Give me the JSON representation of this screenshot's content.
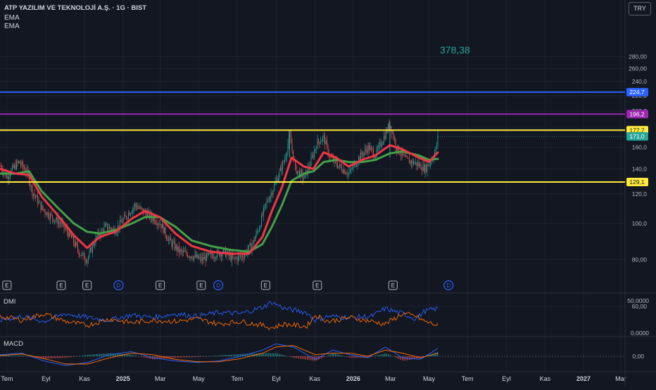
{
  "header": {
    "title": "ATP YAZILIM VE TEKNOLOJİ A.Ş. · 1G · BIST",
    "indicators": [
      "EMA",
      "EMA"
    ],
    "currency": "TRY"
  },
  "annotation": "378,38",
  "chart_data": [
    {
      "type": "line",
      "subtype": "candlestick price chart with EMA overlays",
      "y_axis": {
        "scale": "log",
        "ticks": [
          "280,00",
          "260,00",
          "240,0",
          "220,0",
          "200,0",
          "180,0",
          "160,0",
          "140,0",
          "120,0",
          "100,0",
          "80,00",
          "60,00"
        ],
        "values": [
          280,
          260,
          240,
          220,
          200,
          180,
          160,
          140,
          120,
          100,
          80,
          60
        ]
      },
      "x_axis": {
        "ticks": [
          "Tem",
          "Eyl",
          "Kas",
          "2025",
          "Mar",
          "May",
          "Tem",
          "Eyl",
          "Kas",
          "2026",
          "Mar",
          "May",
          "Tem",
          "Eyl",
          "Kas",
          "2027",
          "Mar"
        ]
      },
      "price_path": [
        [
          "2024-06-20",
          143
        ],
        [
          "2024-07-01",
          133
        ],
        [
          "2024-07-10",
          140
        ],
        [
          "2024-07-20",
          146
        ],
        [
          "2024-08-01",
          138
        ],
        [
          "2024-08-10",
          122
        ],
        [
          "2024-08-25",
          110
        ],
        [
          "2024-09-10",
          104
        ],
        [
          "2024-09-25",
          100
        ],
        [
          "2024-10-10",
          92
        ],
        [
          "2024-10-25",
          83
        ],
        [
          "2024-11-05",
          80
        ],
        [
          "2024-11-20",
          92
        ],
        [
          "2024-12-05",
          98
        ],
        [
          "2024-12-20",
          96
        ],
        [
          "2025-01-05",
          104
        ],
        [
          "2025-01-20",
          112
        ],
        [
          "2025-02-01",
          108
        ],
        [
          "2025-02-15",
          104
        ],
        [
          "2025-03-01",
          100
        ],
        [
          "2025-03-15",
          90
        ],
        [
          "2025-04-01",
          84
        ],
        [
          "2025-04-20",
          82
        ],
        [
          "2025-05-05",
          80
        ],
        [
          "2025-05-20",
          82
        ],
        [
          "2025-06-10",
          84
        ],
        [
          "2025-06-25",
          80
        ],
        [
          "2025-07-10",
          82
        ],
        [
          "2025-07-25",
          88
        ],
        [
          "2025-08-05",
          98
        ],
        [
          "2025-08-15",
          112
        ],
        [
          "2025-08-25",
          122
        ],
        [
          "2025-09-05",
          135
        ],
        [
          "2025-09-15",
          150
        ],
        [
          "2025-09-22",
          172
        ],
        [
          "2025-10-01",
          140
        ],
        [
          "2025-10-15",
          132
        ],
        [
          "2025-10-25",
          145
        ],
        [
          "2025-11-05",
          165
        ],
        [
          "2025-11-15",
          170
        ],
        [
          "2025-11-25",
          150
        ],
        [
          "2025-12-10",
          142
        ],
        [
          "2025-12-25",
          136
        ],
        [
          "2026-01-10",
          150
        ],
        [
          "2026-01-25",
          160
        ],
        [
          "2026-02-05",
          152
        ],
        [
          "2026-02-20",
          172
        ],
        [
          "2026-02-28",
          185
        ],
        [
          "2026-03-10",
          160
        ],
        [
          "2026-03-25",
          148
        ],
        [
          "2026-04-10",
          145
        ],
        [
          "2026-04-25",
          140
        ],
        [
          "2026-05-05",
          148
        ],
        [
          "2026-05-12",
          158
        ],
        [
          "2026-05-15",
          170
        ]
      ],
      "series": [
        {
          "name": "EMA",
          "color": "#f23645",
          "values": [
            [
              "2024-06-20",
              140
            ],
            [
              "2024-07-15",
              136
            ],
            [
              "2024-08-05",
              135
            ],
            [
              "2024-08-25",
              118
            ],
            [
              "2024-09-20",
              105
            ],
            [
              "2024-10-15",
              93
            ],
            [
              "2024-11-05",
              86
            ],
            [
              "2024-11-25",
              92
            ],
            [
              "2024-12-20",
              95
            ],
            [
              "2025-01-15",
              103
            ],
            [
              "2025-02-05",
              108
            ],
            [
              "2025-02-28",
              104
            ],
            [
              "2025-03-25",
              94
            ],
            [
              "2025-04-20",
              87
            ],
            [
              "2025-05-20",
              84
            ],
            [
              "2025-06-20",
              83
            ],
            [
              "2025-07-20",
              83
            ],
            [
              "2025-08-10",
              92
            ],
            [
              "2025-08-25",
              108
            ],
            [
              "2025-09-10",
              125
            ],
            [
              "2025-09-25",
              150
            ],
            [
              "2025-10-15",
              142
            ],
            [
              "2025-10-30",
              140
            ],
            [
              "2025-11-15",
              155
            ],
            [
              "2025-12-05",
              150
            ],
            [
              "2025-12-25",
              142
            ],
            [
              "2026-01-15",
              148
            ],
            [
              "2026-02-05",
              152
            ],
            [
              "2026-02-28",
              162
            ],
            [
              "2026-03-20",
              158
            ],
            [
              "2026-04-15",
              150
            ],
            [
              "2026-05-01",
              146
            ],
            [
              "2026-05-15",
              155
            ]
          ]
        },
        {
          "name": "EMA",
          "color": "#43a047",
          "values": [
            [
              "2024-06-20",
              136
            ],
            [
              "2024-07-15",
              136
            ],
            [
              "2024-08-05",
              138
            ],
            [
              "2024-08-25",
              122
            ],
            [
              "2024-09-20",
              110
            ],
            [
              "2024-10-15",
              100
            ],
            [
              "2024-11-05",
              95
            ],
            [
              "2024-11-25",
              94
            ],
            [
              "2024-12-20",
              96
            ],
            [
              "2025-01-15",
              100
            ],
            [
              "2025-02-05",
              104
            ],
            [
              "2025-02-28",
              104
            ],
            [
              "2025-03-25",
              98
            ],
            [
              "2025-04-20",
              90
            ],
            [
              "2025-05-20",
              87
            ],
            [
              "2025-06-20",
              85
            ],
            [
              "2025-07-20",
              84
            ],
            [
              "2025-08-10",
              88
            ],
            [
              "2025-08-25",
              98
            ],
            [
              "2025-09-10",
              112
            ],
            [
              "2025-09-25",
              130
            ],
            [
              "2025-10-15",
              136
            ],
            [
              "2025-10-30",
              138
            ],
            [
              "2025-11-15",
              146
            ],
            [
              "2025-12-05",
              148
            ],
            [
              "2025-12-25",
              146
            ],
            [
              "2026-01-15",
              146
            ],
            [
              "2026-02-05",
              148
            ],
            [
              "2026-02-28",
              154
            ],
            [
              "2026-03-20",
              156
            ],
            [
              "2026-04-15",
              152
            ],
            [
              "2026-05-01",
              148
            ],
            [
              "2026-05-15",
              149
            ]
          ]
        }
      ],
      "horizontal_lines": [
        {
          "value": 224.7,
          "label": "224,7",
          "color": "#2962ff"
        },
        {
          "value": 196.2,
          "label": "196,2",
          "color": "#9c27b0"
        },
        {
          "value": 177.7,
          "label": "177,7",
          "color": "#ffeb3b"
        },
        {
          "value": 129.1,
          "label": "129,1",
          "color": "#ffeb3b"
        }
      ],
      "last_price": {
        "value": 171.0,
        "label": "171,0",
        "color": "#26a69a"
      },
      "events": [
        {
          "date": "2024-07-01",
          "label": "E"
        },
        {
          "date": "2024-09-25",
          "label": "E"
        },
        {
          "date": "2024-11-05",
          "label": "E"
        },
        {
          "date": "2024-12-25",
          "label": "D"
        },
        {
          "date": "2025-03-01",
          "label": "E"
        },
        {
          "date": "2025-05-05",
          "label": "E"
        },
        {
          "date": "2025-06-01",
          "label": "D"
        },
        {
          "date": "2025-08-15",
          "label": "E"
        },
        {
          "date": "2025-11-05",
          "label": "E"
        },
        {
          "date": "2026-03-05",
          "label": "E"
        },
        {
          "date": "2026-06-01",
          "label": "D"
        }
      ],
      "grid": true
    },
    {
      "type": "line",
      "title": "DMI",
      "y_axis": {
        "ticks": [
          "50,0000",
          "0,0000"
        ],
        "values": [
          50,
          0
        ]
      },
      "series": [
        {
          "color": "#2962ff",
          "values": [
            [
              0,
              20
            ],
            [
              0.05,
              26
            ],
            [
              0.1,
              18
            ],
            [
              0.15,
              30
            ],
            [
              0.2,
              24
            ],
            [
              0.25,
              20
            ],
            [
              0.3,
              28
            ],
            [
              0.35,
              24
            ],
            [
              0.4,
              30
            ],
            [
              0.45,
              26
            ],
            [
              0.5,
              32
            ],
            [
              0.55,
              30
            ],
            [
              0.6,
              40
            ],
            [
              0.62,
              48
            ],
            [
              0.65,
              38
            ],
            [
              0.7,
              32
            ],
            [
              0.72,
              20
            ],
            [
              0.75,
              26
            ],
            [
              0.8,
              24
            ],
            [
              0.85,
              26
            ],
            [
              0.88,
              38
            ],
            [
              0.92,
              30
            ],
            [
              0.95,
              22
            ],
            [
              0.97,
              34
            ],
            [
              1.0,
              38
            ]
          ]
        },
        {
          "color": "#ff6d00",
          "values": [
            [
              0,
              26
            ],
            [
              0.05,
              20
            ],
            [
              0.1,
              30
            ],
            [
              0.15,
              18
            ],
            [
              0.2,
              12
            ],
            [
              0.25,
              22
            ],
            [
              0.3,
              16
            ],
            [
              0.35,
              20
            ],
            [
              0.4,
              18
            ],
            [
              0.45,
              22
            ],
            [
              0.5,
              14
            ],
            [
              0.55,
              18
            ],
            [
              0.6,
              12
            ],
            [
              0.62,
              8
            ],
            [
              0.65,
              14
            ],
            [
              0.7,
              10
            ],
            [
              0.72,
              28
            ],
            [
              0.75,
              18
            ],
            [
              0.8,
              24
            ],
            [
              0.85,
              18
            ],
            [
              0.88,
              14
            ],
            [
              0.92,
              30
            ],
            [
              0.95,
              26
            ],
            [
              0.97,
              18
            ],
            [
              1.0,
              12
            ]
          ]
        }
      ]
    },
    {
      "type": "line",
      "title": "MACD",
      "y_axis": {
        "ticks": [
          "0,00"
        ],
        "values": [
          0
        ]
      },
      "series": [
        {
          "color": "#2962ff",
          "values": [
            [
              0,
              1
            ],
            [
              0.05,
              2
            ],
            [
              0.1,
              -3
            ],
            [
              0.15,
              -6
            ],
            [
              0.2,
              -4
            ],
            [
              0.25,
              1
            ],
            [
              0.3,
              3
            ],
            [
              0.35,
              -1
            ],
            [
              0.4,
              -3
            ],
            [
              0.45,
              -4
            ],
            [
              0.5,
              -3
            ],
            [
              0.55,
              0
            ],
            [
              0.6,
              4
            ],
            [
              0.63,
              8
            ],
            [
              0.67,
              6
            ],
            [
              0.72,
              -2
            ],
            [
              0.76,
              4
            ],
            [
              0.8,
              1
            ],
            [
              0.84,
              -1
            ],
            [
              0.88,
              6
            ],
            [
              0.92,
              -1
            ],
            [
              0.96,
              -2
            ],
            [
              1.0,
              5
            ]
          ]
        },
        {
          "color": "#ff6d00",
          "values": [
            [
              0,
              0.5
            ],
            [
              0.05,
              1.5
            ],
            [
              0.1,
              -1.5
            ],
            [
              0.15,
              -5
            ],
            [
              0.2,
              -5
            ],
            [
              0.25,
              -1
            ],
            [
              0.3,
              2
            ],
            [
              0.35,
              1
            ],
            [
              0.4,
              -2
            ],
            [
              0.45,
              -3.5
            ],
            [
              0.5,
              -3.5
            ],
            [
              0.55,
              -1.5
            ],
            [
              0.6,
              2
            ],
            [
              0.63,
              6
            ],
            [
              0.67,
              7
            ],
            [
              0.72,
              1
            ],
            [
              0.76,
              2
            ],
            [
              0.8,
              2
            ],
            [
              0.84,
              0
            ],
            [
              0.88,
              4
            ],
            [
              0.92,
              2
            ],
            [
              0.96,
              -1
            ],
            [
              1.0,
              2
            ]
          ]
        }
      ]
    }
  ]
}
